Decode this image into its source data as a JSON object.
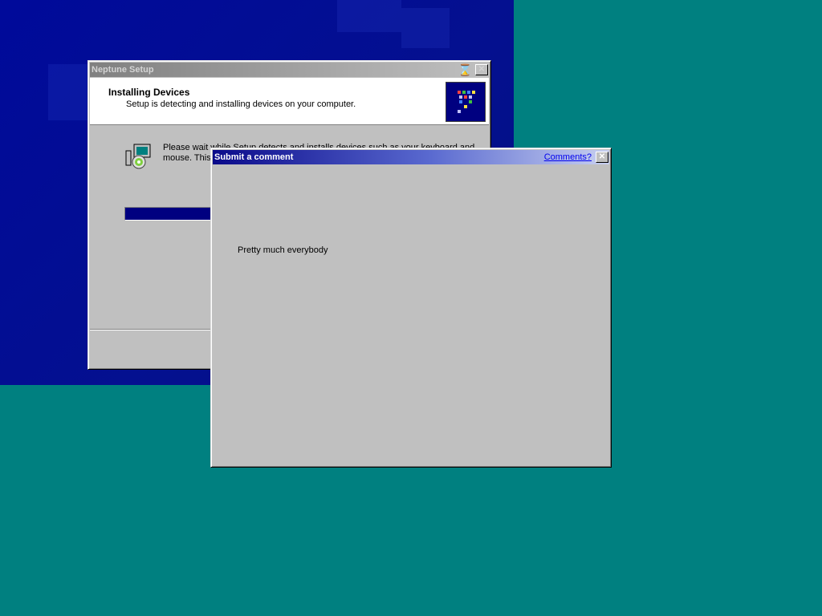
{
  "setup_window": {
    "title": "Neptune Setup",
    "header_title": "Installing Devices",
    "header_subtitle": "Setup is detecting and installing devices on your computer.",
    "body_text": "Please wait while Setup detects and installs devices such as your keyboard and mouse.  This will take a few seconds.",
    "progress": 0.4,
    "close_symbol": "✕",
    "busy_symbol": "⌛"
  },
  "comment_dialog": {
    "title": "Submit a comment",
    "comments_link": "Comments?",
    "close_symbol": "✕",
    "message": "Pretty much everybody"
  },
  "colors": {
    "desktop": "#008080",
    "active_title": "#0a0a8a",
    "inactive_title": "#808080",
    "progress": "#000080"
  }
}
